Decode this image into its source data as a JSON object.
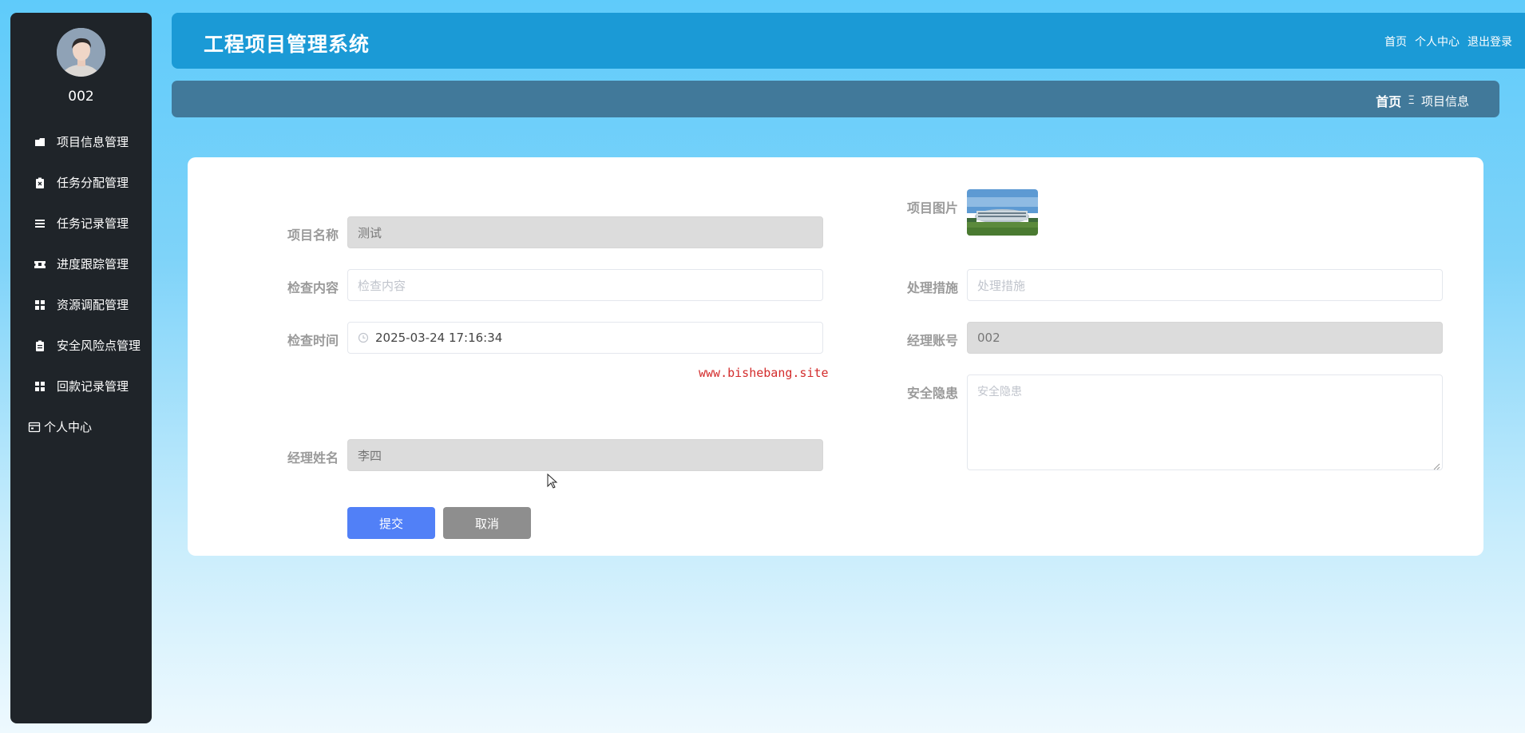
{
  "sidebar": {
    "username": "002",
    "items": [
      {
        "label": "项目信息管理",
        "icon": "folder-icon"
      },
      {
        "label": "任务分配管理",
        "icon": "clipboard-icon"
      },
      {
        "label": "任务记录管理",
        "icon": "list-icon"
      },
      {
        "label": "进度跟踪管理",
        "icon": "ticket-icon"
      },
      {
        "label": "资源调配管理",
        "icon": "grid-icon"
      },
      {
        "label": "安全风险点管理",
        "icon": "clipboard-icon"
      },
      {
        "label": "回款记录管理",
        "icon": "grid-icon"
      },
      {
        "label": "个人中心",
        "icon": "calendar-icon"
      }
    ]
  },
  "header": {
    "title": "工程项目管理系统",
    "links": [
      "首页",
      "个人中心",
      "退出登录"
    ]
  },
  "breadcrumb": {
    "home": "首页",
    "separator": "Ξ",
    "current": "项目信息"
  },
  "form": {
    "project_name": {
      "label": "项目名称",
      "value": "测试"
    },
    "check_content": {
      "label": "检查内容",
      "placeholder": "检查内容"
    },
    "check_time": {
      "label": "检查时间",
      "value": "2025-03-24 17:16:34"
    },
    "manager_name": {
      "label": "经理姓名",
      "value": "李四"
    },
    "project_image": {
      "label": "项目图片"
    },
    "measures": {
      "label": "处理措施",
      "placeholder": "处理措施"
    },
    "manager_account": {
      "label": "经理账号",
      "value": "002"
    },
    "hazard": {
      "label": "安全隐患",
      "placeholder": "安全隐患"
    },
    "submit_label": "提交",
    "cancel_label": "取消"
  },
  "watermark": "www.bishebang.site",
  "colors": {
    "sidebar_bg": "#1f2429",
    "header_bg": "#1b9ad6",
    "breadcrumb_bg": "#41799a",
    "submit_bg": "#5180f7",
    "cancel_bg": "#8e8e8e",
    "watermark": "#d32c2c"
  }
}
